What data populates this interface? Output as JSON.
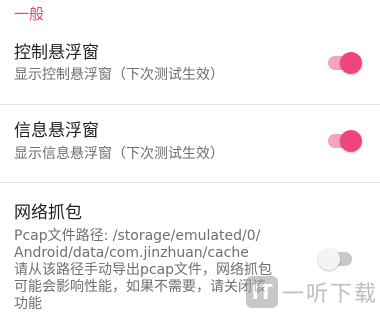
{
  "section": {
    "header": "一般"
  },
  "prefs": [
    {
      "title": "控制悬浮窗",
      "summary": "显示控制悬浮窗（下次测试生效）",
      "enabled": true
    },
    {
      "title": "信息悬浮窗",
      "summary": "显示信息悬浮窗（下次测试生效）",
      "enabled": true
    },
    {
      "title": "网络抓包",
      "summary_lines": [
        "Pcap文件路径: /storage/emulated/0/",
        "Android/data/com.jinzhuan/cache",
        "请从该路径手动导出pcap文件，网络抓包",
        "可能会影响性能，如果不需要，请关闭该",
        "功能"
      ],
      "enabled": false
    }
  ],
  "colors": {
    "accent": "#f0457a",
    "accent_track": "#f6a3bf",
    "header": "#e8467a"
  },
  "watermark": {
    "logo_glyph": "IT",
    "text": "一听下载"
  }
}
